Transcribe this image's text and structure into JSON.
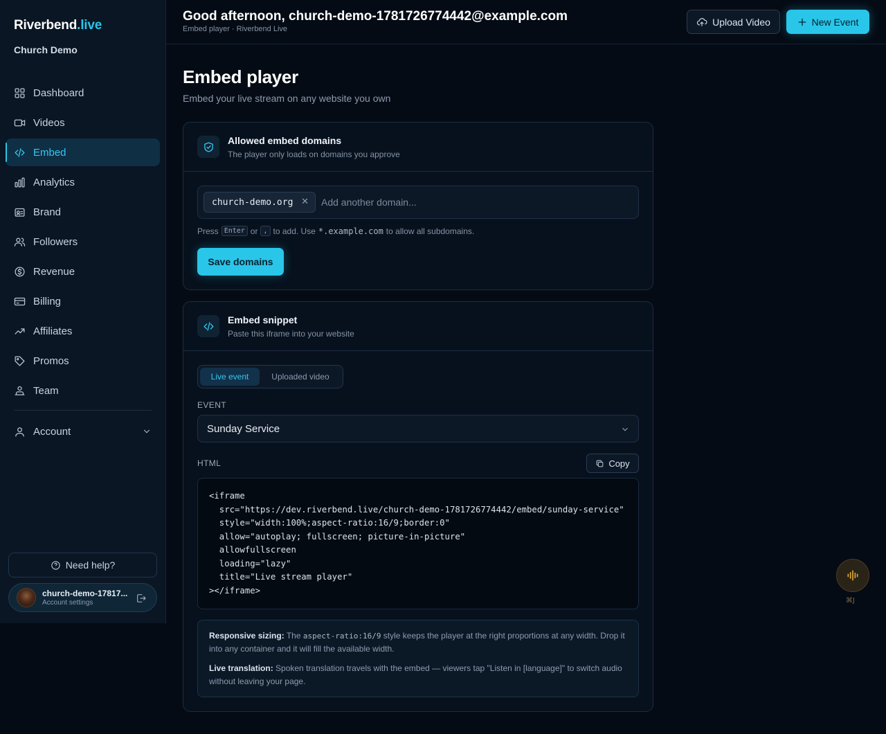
{
  "brand": {
    "name": "Riverbend",
    "accent": ".live"
  },
  "org": "Church Demo",
  "nav": [
    {
      "label": "Dashboard",
      "icon": "dashboard-icon"
    },
    {
      "label": "Videos",
      "icon": "video-icon"
    },
    {
      "label": "Embed",
      "icon": "code-icon",
      "active": true
    },
    {
      "label": "Analytics",
      "icon": "bar-chart-icon"
    },
    {
      "label": "Brand",
      "icon": "id-card-icon"
    },
    {
      "label": "Followers",
      "icon": "users-icon"
    },
    {
      "label": "Revenue",
      "icon": "dollar-circle-icon"
    },
    {
      "label": "Billing",
      "icon": "credit-card-icon"
    },
    {
      "label": "Affiliates",
      "icon": "trending-up-icon"
    },
    {
      "label": "Promos",
      "icon": "tag-icon"
    },
    {
      "label": "Team",
      "icon": "team-icon"
    }
  ],
  "account": {
    "label": "Account"
  },
  "help": {
    "label": "Need help?"
  },
  "user": {
    "name": "church-demo-17817...",
    "sub": "Account settings"
  },
  "header": {
    "greeting": "Good afternoon, church-demo-1781726774442@example.com",
    "breadcrumb": "Embed player · Riverbend Live",
    "upload_label": "Upload Video",
    "new_event_label": "New Event"
  },
  "page": {
    "title": "Embed player",
    "subtitle": "Embed your live stream on any website you own"
  },
  "domains_card": {
    "title": "Allowed embed domains",
    "description": "The player only loads on domains you approve",
    "chip": "church-demo.org",
    "input_placeholder": "Add another domain...",
    "hint_press": "Press",
    "hint_enter": "Enter",
    "hint_or": "or",
    "hint_comma": ",",
    "hint_to_add": "to add. Use",
    "hint_wildcard": "*.example.com",
    "hint_suffix": "to allow all subdomains.",
    "save_label": "Save domains"
  },
  "snippet_card": {
    "title": "Embed snippet",
    "description": "Paste this iframe into your website",
    "tabs": [
      "Live event",
      "Uploaded video"
    ],
    "event_label": "EVENT",
    "event_value": "Sunday Service",
    "html_label": "HTML",
    "copy_label": "Copy",
    "code": "<iframe\n  src=\"https://dev.riverbend.live/church-demo-1781726774442/embed/sunday-service\"\n  style=\"width:100%;aspect-ratio:16/9;border:0\"\n  allow=\"autoplay; fullscreen; picture-in-picture\"\n  allowfullscreen\n  loading=\"lazy\"\n  title=\"Live stream player\"\n></iframe>",
    "note1_title": "Responsive sizing:",
    "note1_pre": "The",
    "note1_code": "aspect-ratio:16/9",
    "note1_post": "style keeps the player at the right proportions at any width. Drop it into any container and it will fill the available width.",
    "note2_title": "Live translation:",
    "note2_text": "Spoken translation travels with the embed — viewers tap \"Listen in [language]\" to switch audio without leaving your page."
  },
  "voice": {
    "shortcut": "⌘J"
  },
  "colors": {
    "accent": "#29c6ea",
    "background": "#050b14",
    "sidebar": "#0a1624",
    "voice": "#e0a83a"
  }
}
